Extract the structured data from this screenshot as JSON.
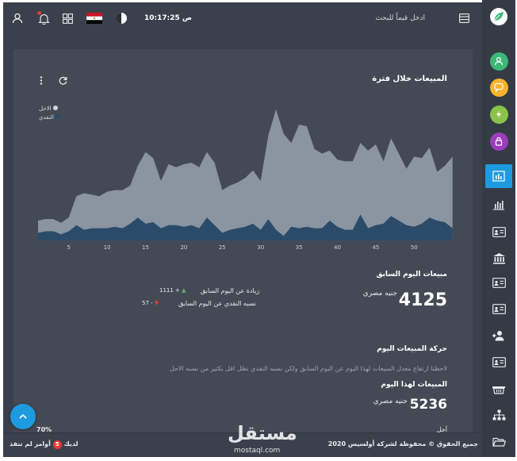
{
  "topbar": {
    "search_placeholder": "ادخل قيماً للبحث",
    "time": "10:17:25 ص",
    "notification_count": 1
  },
  "sidebar": {
    "items": [
      {
        "name": "user",
        "icon": "user-icon",
        "color": "#3cb878"
      },
      {
        "name": "messages",
        "icon": "chat-icon",
        "color": "#f8b32d"
      },
      {
        "name": "activity",
        "icon": "bolt-icon",
        "color": "#8bc34a"
      },
      {
        "name": "security",
        "icon": "lock-icon",
        "color": "#9c3dbd"
      },
      {
        "name": "sales-chart",
        "icon": "bar-chart-icon",
        "active": true
      },
      {
        "name": "reports",
        "icon": "bar-chart-outline-icon"
      },
      {
        "name": "cards",
        "icon": "id-card-icon"
      },
      {
        "name": "bank",
        "icon": "bank-icon"
      },
      {
        "name": "cards-2",
        "icon": "id-card-icon"
      },
      {
        "name": "cards-3",
        "icon": "id-card-icon"
      },
      {
        "name": "add-user",
        "icon": "user-plus-icon"
      },
      {
        "name": "cards-4",
        "icon": "id-card-icon"
      },
      {
        "name": "basket",
        "icon": "basket-icon"
      },
      {
        "name": "hierarchy",
        "icon": "sitemap-icon"
      },
      {
        "name": "folder",
        "icon": "folder-icon"
      }
    ]
  },
  "card": {
    "title": "المبيعات خلال فترة",
    "legend": [
      "الاجل",
      "النقدي"
    ]
  },
  "chart_data": {
    "type": "area",
    "series": [
      {
        "name": "الاجل",
        "color": "#8a95a1",
        "values": [
          26,
          28,
          28,
          23,
          30,
          58,
          62,
          60,
          58,
          64,
          66,
          66,
          72,
          98,
          116,
          108,
          78,
          100,
          96,
          100,
          102,
          96,
          116,
          102,
          66,
          72,
          76,
          82,
          92,
          78,
          138,
          172,
          140,
          128,
          152,
          150,
          120,
          114,
          118,
          106,
          104,
          104,
          128,
          118,
          126,
          104,
          134,
          114,
          94,
          110,
          108,
          122,
          90,
          98,
          110
        ]
      },
      {
        "name": "النقدي",
        "color": "#2b4b6a",
        "values": [
          10,
          12,
          12,
          8,
          12,
          20,
          14,
          16,
          16,
          16,
          18,
          16,
          22,
          30,
          22,
          24,
          16,
          20,
          20,
          18,
          20,
          16,
          30,
          20,
          10,
          14,
          16,
          18,
          22,
          14,
          28,
          14,
          6,
          18,
          16,
          18,
          16,
          16,
          26,
          18,
          14,
          14,
          34,
          16,
          20,
          22,
          32,
          26,
          20,
          18,
          22,
          30,
          26,
          24,
          16
        ]
      }
    ],
    "x_ticks": [
      5,
      10,
      15,
      20,
      25,
      30,
      35,
      40,
      45,
      50
    ],
    "xlim": [
      1,
      54
    ],
    "ylim": [
      0,
      175
    ],
    "grid": false,
    "legend_position": "top-left"
  },
  "yesterday": {
    "title": "مبيعات اليوم السابق",
    "value": "4125",
    "currency": "جنيه مصري",
    "increase_label": "زيادة عن اليوم السابق",
    "increase_value": "1111 +",
    "cash_label": "نسبه النقدي عن اليوم السابق",
    "cash_value": "57 -",
    "up_color": "#5cb85c",
    "down_color": "#e53935"
  },
  "today": {
    "movement_title": "حركة المبيعات اليوم",
    "note": "لاحظنا ارتفاع معدل المبيعات لهذا اليوم عن اليوم السابق ولكن نسبه النقدي تظل اقل بكثير من نسبه الاجل",
    "sales_title": "المبيعات لهذا اليوم",
    "value": "5236",
    "currency": "جنيه مصري",
    "percent": "70%",
    "cut_label": "آجل"
  },
  "footer": {
    "copyright": "جميع الحقوق © محفوظة لشركة أولسيس 2020",
    "pending_text": "أوامر لم تنفذ",
    "pending_count": "5",
    "you_have": "لديك"
  },
  "watermark": {
    "arabic": "مستقل",
    "latin": "mostaql.com"
  }
}
